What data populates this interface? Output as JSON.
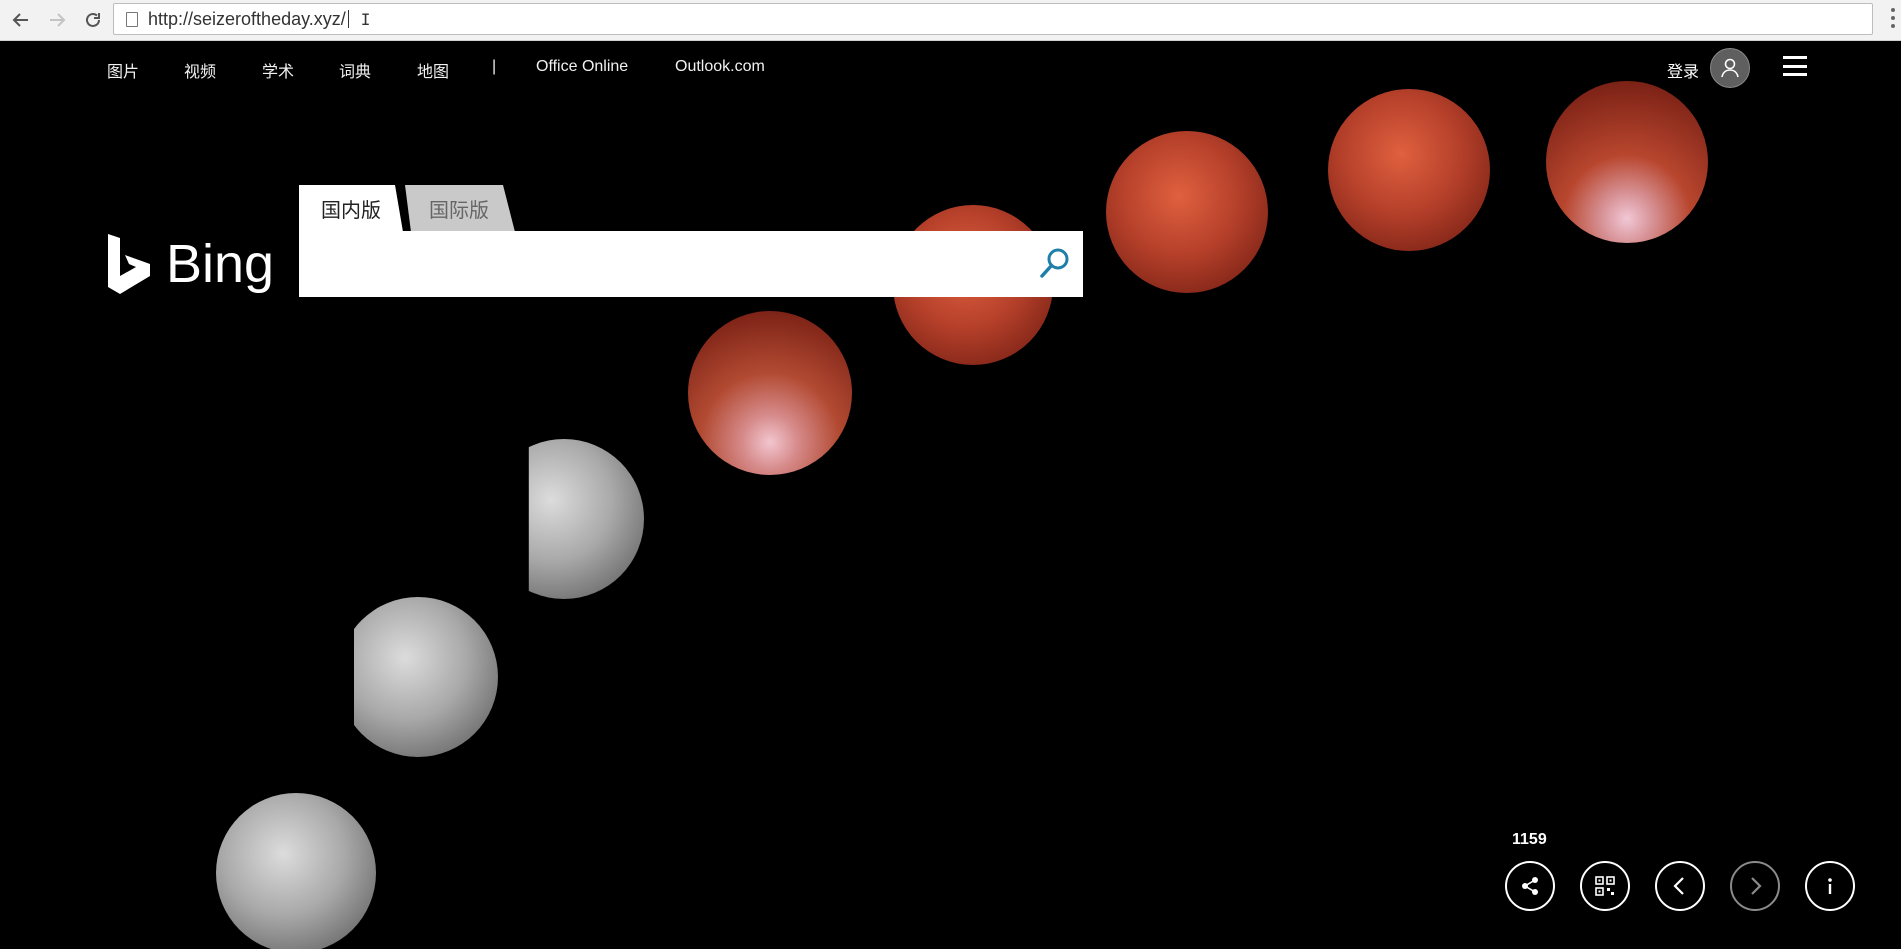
{
  "browser": {
    "url": "http://seizeroftheday.xyz/",
    "back_icon": "arrow-left-icon",
    "forward_icon": "arrow-right-icon",
    "reload_icon": "reload-icon"
  },
  "nav": {
    "links": [
      "图片",
      "视频",
      "学术",
      "词典",
      "地图"
    ],
    "separator": "|",
    "office": "Office Online",
    "outlook": "Outlook.com",
    "login": "登录"
  },
  "logo": {
    "text": "Bing"
  },
  "search": {
    "tabs": [
      "国内版",
      "国际版"
    ],
    "value": "",
    "placeholder": ""
  },
  "footer": {
    "count": "1159",
    "buttons": [
      "share-icon",
      "qr-code-icon",
      "chevron-left-icon",
      "chevron-right-icon",
      "info-icon"
    ]
  },
  "colors": {
    "accent": "#1f7fa8",
    "background": "#000000"
  }
}
